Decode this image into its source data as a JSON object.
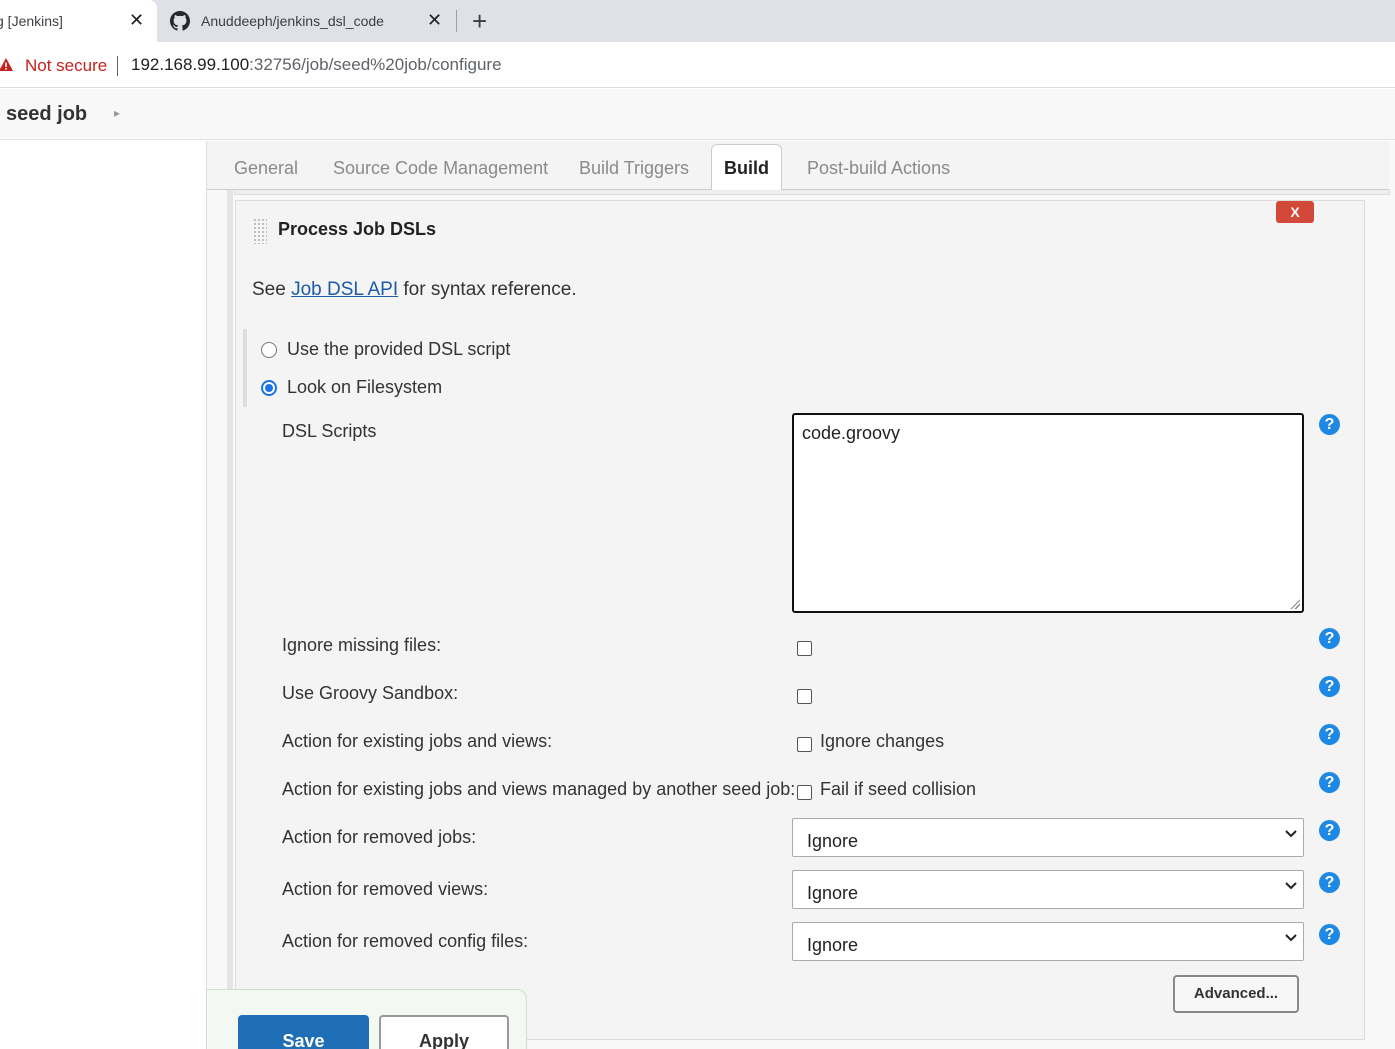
{
  "browser": {
    "tabs": [
      {
        "title": "g [Jenkins]",
        "close": "✕"
      },
      {
        "title": "Anuddeeph/jenkins_dsl_code",
        "close": "✕",
        "icon": "github-icon"
      }
    ],
    "new_tab": "+",
    "security_label": "Not secure",
    "url_host": "192.168.99.100",
    "url_rest": ":32756/job/seed%20job/configure"
  },
  "breadcrumb": {
    "job": "seed job",
    "arrow": "▸"
  },
  "config_tabs": [
    "General",
    "Source Code Management",
    "Build Triggers",
    "Build",
    "Post-build Actions"
  ],
  "active_tab": "Build",
  "step": {
    "delete_label": "X",
    "title": "Process Job DSLs",
    "see_prefix": "See ",
    "see_link": "Job DSL API",
    "see_suffix": " for syntax reference.",
    "radio_options": [
      {
        "label": "Use the provided DSL script",
        "checked": false
      },
      {
        "label": "Look on Filesystem",
        "checked": true
      }
    ],
    "dsl_scripts_label": "DSL Scripts",
    "dsl_scripts_value": "code.groovy",
    "ignore_missing_label": "Ignore missing files:",
    "groovy_sandbox_label": "Use Groovy Sandbox:",
    "existing_jobs_label": "Action for existing jobs and views:",
    "existing_jobs_option": "Ignore changes",
    "seed_collision_label": "Action for existing jobs and views managed by another seed job:",
    "seed_collision_option": "Fail if seed collision",
    "removed_jobs_label": "Action for removed jobs:",
    "removed_jobs_value": "Ignore",
    "removed_views_label": "Action for removed views:",
    "removed_views_value": "Ignore",
    "removed_config_label": "Action for removed config files:",
    "removed_config_value": "Ignore",
    "help_glyph": "?",
    "advanced_label": "Advanced..."
  },
  "buttons": {
    "save": "Save",
    "apply": "Apply"
  },
  "colors": {
    "save": "#1e6fb6",
    "delete": "#d24939",
    "help": "#1e88e5",
    "link": "#1d5ba8",
    "warning": "#c5221f"
  }
}
